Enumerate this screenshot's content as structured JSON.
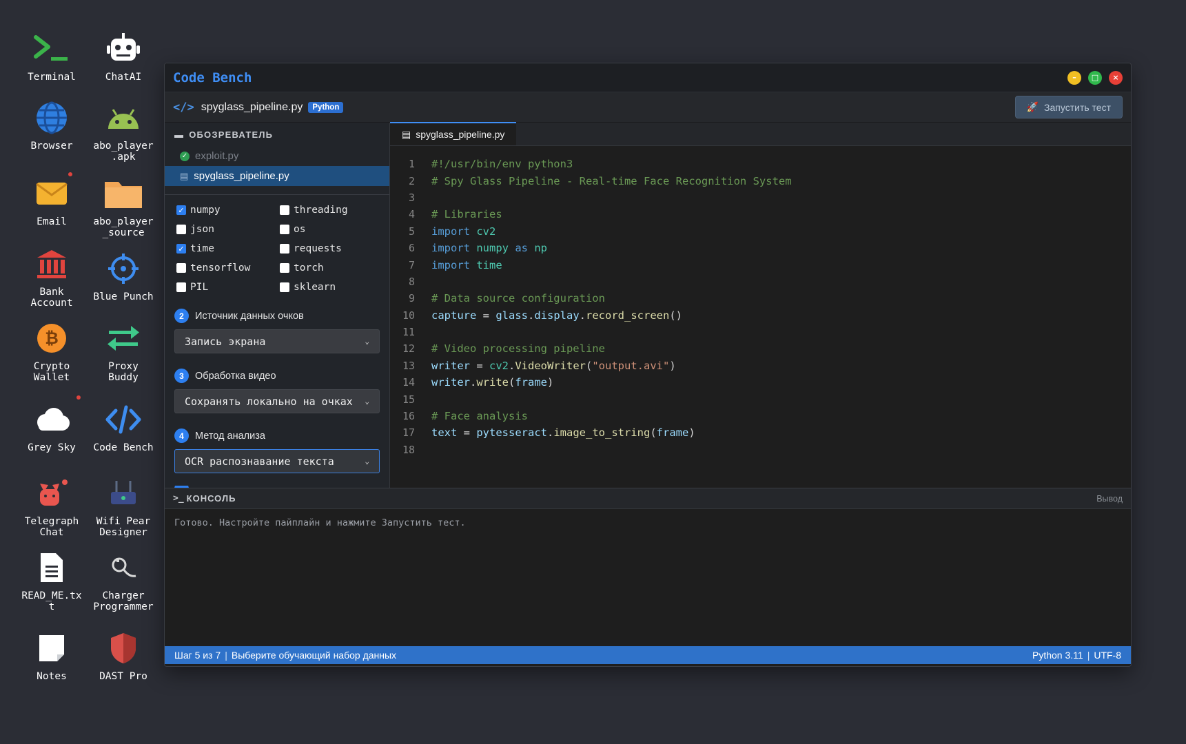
{
  "desktop": {
    "icons": [
      {
        "name": "Terminal",
        "label": "Terminal"
      },
      {
        "name": "ChatAI",
        "label": "ChatAI"
      },
      {
        "name": "Browser",
        "label": "Browser"
      },
      {
        "name": "abo_player_apk",
        "label": "abo_player\n.apk"
      },
      {
        "name": "Email",
        "label": "Email"
      },
      {
        "name": "abo_player_source",
        "label": "abo_player\n_source"
      },
      {
        "name": "Bank Account",
        "label": "Bank\nAccount"
      },
      {
        "name": "Blue Punch",
        "label": "Blue Punch"
      },
      {
        "name": "Crypto Wallet",
        "label": "Crypto\nWallet"
      },
      {
        "name": "Proxy Buddy",
        "label": "Proxy\nBuddy"
      },
      {
        "name": "Grey Sky",
        "label": "Grey Sky"
      },
      {
        "name": "Code Bench",
        "label": "Code Bench"
      },
      {
        "name": "Telegraph Chat",
        "label": "Telegraph\nChat"
      },
      {
        "name": "Wifi Pear Designer",
        "label": "Wifi Pear\nDesigner"
      },
      {
        "name": "READ_ME.txt",
        "label": "READ_ME.tx\nt"
      },
      {
        "name": "Charger Programmer",
        "label": "Charger\nProgrammer"
      },
      {
        "name": "Notes",
        "label": "Notes"
      },
      {
        "name": "DAST Pro",
        "label": "DAST Pro"
      }
    ]
  },
  "window": {
    "title": "Code Bench",
    "controls": {
      "minimize": "–",
      "maximize": "□",
      "close": "×"
    }
  },
  "filebar": {
    "filename": "spyglass_pipeline.py",
    "language": "Python",
    "run_label": "Запустить тест"
  },
  "explorer": {
    "title": "ОБОЗРЕВАТЕЛЬ",
    "files": [
      {
        "name": "exploit.py",
        "state": "done"
      },
      {
        "name": "spyglass_pipeline.py",
        "state": "active"
      }
    ]
  },
  "config": {
    "libraries": [
      {
        "name": "numpy",
        "checked": true
      },
      {
        "name": "threading",
        "checked": false
      },
      {
        "name": "json",
        "checked": false
      },
      {
        "name": "os",
        "checked": false
      },
      {
        "name": "time",
        "checked": true
      },
      {
        "name": "requests",
        "checked": false
      },
      {
        "name": "tensorflow",
        "checked": false
      },
      {
        "name": "torch",
        "checked": false
      },
      {
        "name": "PIL",
        "checked": false
      },
      {
        "name": "sklearn",
        "checked": false
      }
    ],
    "steps": [
      {
        "num": "2",
        "title": "Источник данных очков",
        "value": "Запись экрана"
      },
      {
        "num": "3",
        "title": "Обработка видео",
        "value": "Сохранять локально на очках"
      },
      {
        "num": "4",
        "title": "Метод анализа",
        "value": "OCR распознавание текста"
      }
    ]
  },
  "editor": {
    "tab": "spyglass_pipeline.py",
    "lines": [
      "#!/usr/bin/env python3",
      "# Spy Glass Pipeline - Real-time Face Recognition System",
      "",
      "# Libraries",
      "import cv2",
      "import numpy as np",
      "import time",
      "",
      "# Data source configuration",
      "capture = glass.display.record_screen()",
      "",
      "# Video processing pipeline",
      "writer = cv2.VideoWriter(\"output.avi\")",
      "writer.write(frame)",
      "",
      "# Face analysis",
      "text = pytesseract.image_to_string(frame)",
      ""
    ]
  },
  "console": {
    "title": "КОНСОЛЬ",
    "output_label": "Вывод",
    "message": "Готово. Настройте пайплайн и нажмите Запустить тест."
  },
  "status": {
    "step": "Шаг 5 из 7",
    "hint": "Выберите обучающий набор данных",
    "python": "Python 3.11",
    "encoding": "UTF-8"
  }
}
